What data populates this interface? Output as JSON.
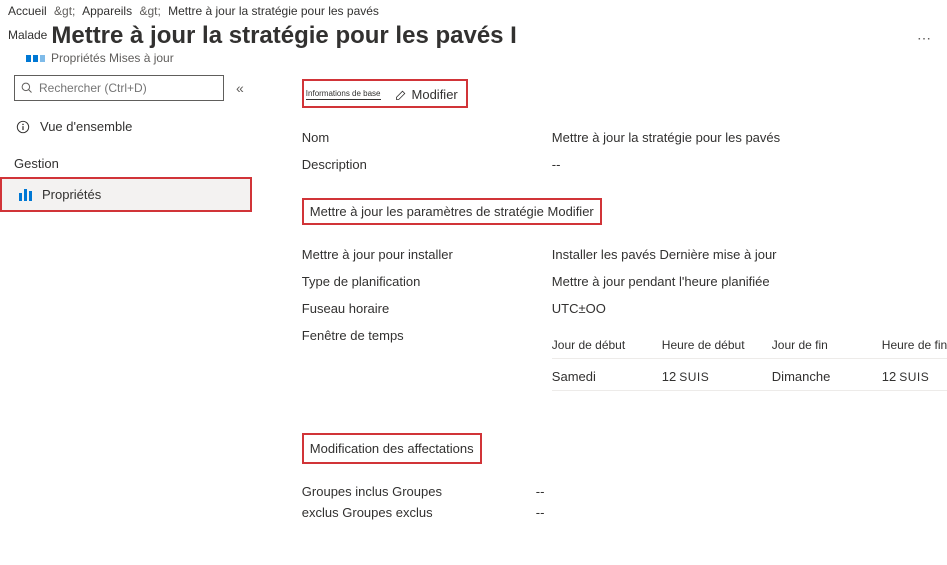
{
  "breadcrumb": {
    "home": "Accueil",
    "devices": "Appareils",
    "current": "Mettre à jour la stratégie pour les pavés",
    "sep": "&gt;"
  },
  "header": {
    "badge": "Malade",
    "title": "Mettre à jour la stratégie pour les pavés I",
    "subtitle": "Propriétés Mises à jour"
  },
  "sidebar": {
    "searchPlaceholder": "Rechercher (Ctrl+D)",
    "overview": "Vue d'ensemble",
    "sectionGestion": "Gestion",
    "properties": "Propriétés"
  },
  "section_basics": {
    "hint": "Informations de base",
    "edit": "Modifier",
    "rows": [
      {
        "label": "Nom",
        "value": "Mettre à jour la stratégie pour les pavés"
      },
      {
        "label": "Description",
        "value": "--"
      }
    ]
  },
  "section_settings": {
    "title": "Mettre à jour les paramètres de stratégie Modifier",
    "rows": [
      {
        "label": "Mettre à jour pour installer",
        "value": "Installer les pavés Dernière mise à jour"
      },
      {
        "label": "Type de planification",
        "value": "Mettre à jour pendant l'heure planifiée"
      },
      {
        "label": "Fuseau horaire",
        "value": "UTC±OO"
      }
    ],
    "timewindow_label": "Fenêtre de temps",
    "table": {
      "headers": [
        "Jour de début",
        "Heure de début",
        "Jour de fin",
        "Heure de fin"
      ],
      "row": {
        "startDay": "Samedi",
        "startHourNum": "12",
        "startHourAP": "SUIS",
        "endDay": "Dimanche",
        "endHourNum": "12",
        "endHourAP": "SUIS"
      }
    }
  },
  "section_assign": {
    "title": "Modification des affectations",
    "rows": [
      {
        "label": "Groupes inclus Groupes",
        "value": "--"
      },
      {
        "label": "exclus Groupes exclus",
        "value": "--"
      }
    ]
  }
}
